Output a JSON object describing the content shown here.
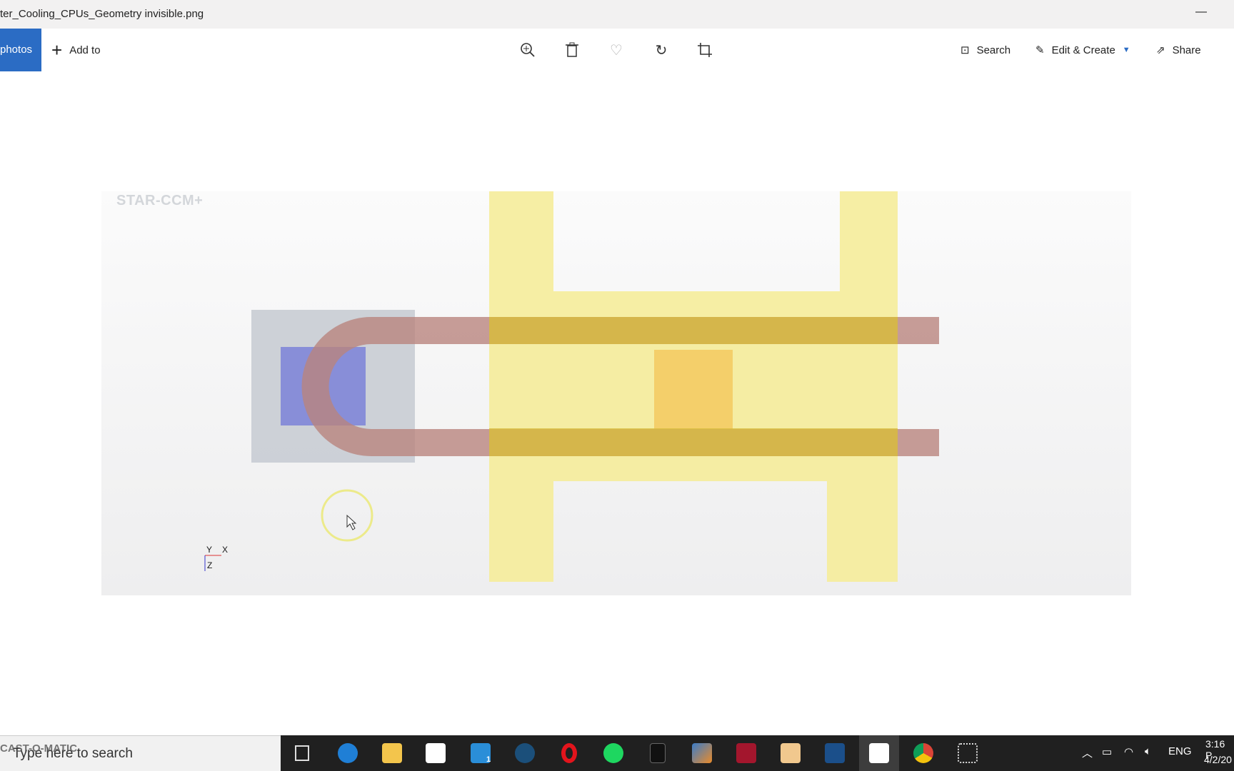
{
  "window": {
    "title": "ter_Cooling_CPUs_Geometry invisible.png",
    "minimize": "—"
  },
  "toolbar": {
    "photos_label": "photos",
    "add_to_label": "Add to",
    "search_label": "Search",
    "edit_create_label": "Edit & Create",
    "share_label": "Share",
    "icons": [
      "zoom-in-icon",
      "delete-icon",
      "heart-icon",
      "rotate-icon",
      "crop-icon"
    ]
  },
  "image": {
    "logo_text": "STAR-CCM+",
    "axis_y": "Y",
    "axis_x": "X",
    "axis_z": "Z",
    "colors": {
      "frame": "#f5ec9a",
      "pipe": "#b9857e",
      "block": "#c6cad1",
      "cpu": "#7b82d8",
      "hot": "#f4cf6a"
    }
  },
  "taskbar": {
    "search_placeholder": "Type here to search",
    "watermark": "CAST-O-MATIC",
    "mail_badge": "1",
    "apps": [
      "task-view",
      "edge",
      "file-explorer",
      "store",
      "mail",
      "steam",
      "opera",
      "spotify",
      "epic-games",
      "matlab",
      "mendeley",
      "inventor",
      "autocad-2019",
      "photos",
      "chrome",
      "snipping-tool"
    ],
    "language": "ENG",
    "time": "3:16 P",
    "date": "4/2/20"
  }
}
